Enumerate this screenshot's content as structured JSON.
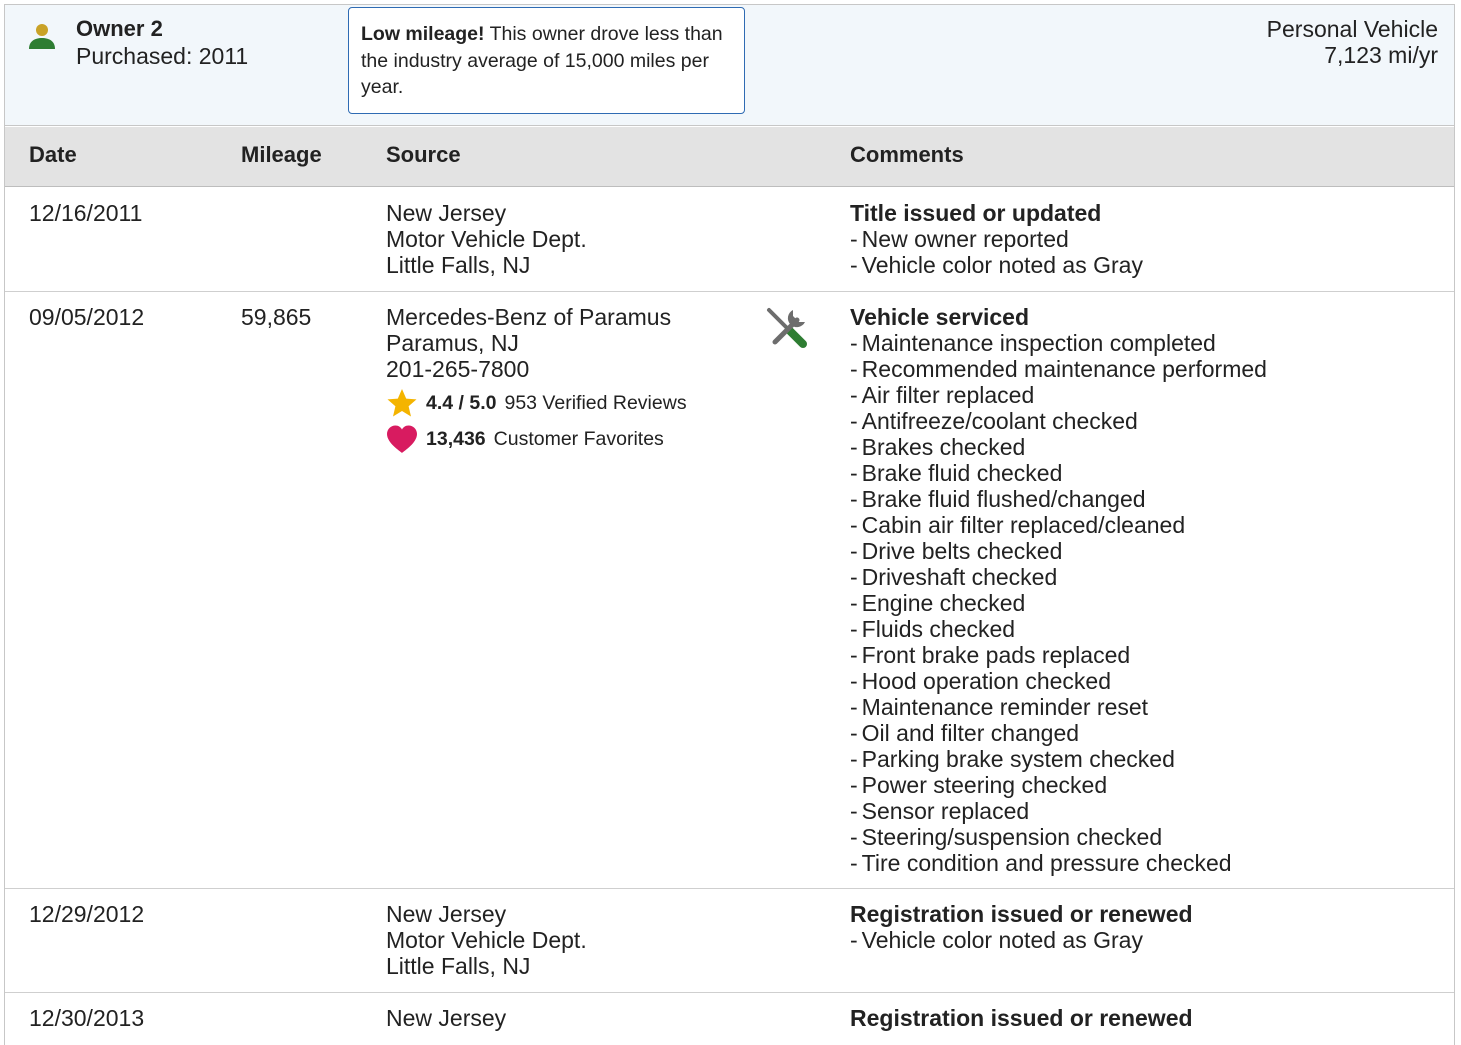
{
  "owner": {
    "name": "Owner 2",
    "purchased": "Purchased: 2011",
    "note_bold": "Low mileage!",
    "note_text": " This owner drove less than the industry average of 15,000 miles per year.",
    "vehicle_type": "Personal Vehicle",
    "miles_per_year": "7,123 mi/yr"
  },
  "columns": {
    "date": "Date",
    "mileage": "Mileage",
    "source": "Source",
    "comments": "Comments"
  },
  "rows": [
    {
      "date": "12/16/2011",
      "mileage": "",
      "source": [
        "New Jersey",
        "Motor Vehicle Dept.",
        "Little Falls, NJ"
      ],
      "comment_title": "Title issued or updated",
      "comments": [
        "New owner reported",
        "Vehicle color noted as Gray"
      ]
    },
    {
      "date": "09/05/2012",
      "mileage": "59,865",
      "source": [
        "Mercedes-Benz of Paramus",
        "Paramus, NJ",
        "201-265-7800"
      ],
      "rating": "4.4 / 5.0",
      "reviews": "953 Verified Reviews",
      "favorites_count": "13,436",
      "favorites_label": "Customer Favorites",
      "comment_title": "Vehicle serviced",
      "comments": [
        "Maintenance inspection completed",
        "Recommended maintenance performed",
        "Air filter replaced",
        "Antifreeze/coolant checked",
        "Brakes checked",
        "Brake fluid checked",
        "Brake fluid flushed/changed",
        "Cabin air filter replaced/cleaned",
        "Drive belts checked",
        "Driveshaft checked",
        "Engine checked",
        "Fluids checked",
        "Front brake pads replaced",
        "Hood operation checked",
        "Maintenance reminder reset",
        "Oil and filter changed",
        "Parking brake system checked",
        "Power steering checked",
        "Sensor replaced",
        "Steering/suspension checked",
        "Tire condition and pressure checked"
      ]
    },
    {
      "date": "12/29/2012",
      "mileage": "",
      "source": [
        "New Jersey",
        "Motor Vehicle Dept.",
        "Little Falls, NJ"
      ],
      "comment_title": "Registration issued or renewed",
      "comments": [
        "Vehicle color noted as Gray"
      ]
    },
    {
      "date": "12/30/2013",
      "mileage": "",
      "source": [
        "New Jersey"
      ],
      "comment_title": "Registration issued or renewed",
      "comments": []
    }
  ],
  "colors": {
    "owner_icon_head": "#c9a227",
    "owner_icon_body": "#2e7d32",
    "note_border": "#2f6bb3",
    "star": "#f4b400",
    "heart": "#d81b60",
    "wrench_handle": "#2e7d32",
    "tool_gray": "#6d6d6d"
  },
  "icons": {
    "owner": "person-icon",
    "service": "wrench-screwdriver-icon",
    "rating": "star-icon",
    "favorites": "heart-icon"
  }
}
